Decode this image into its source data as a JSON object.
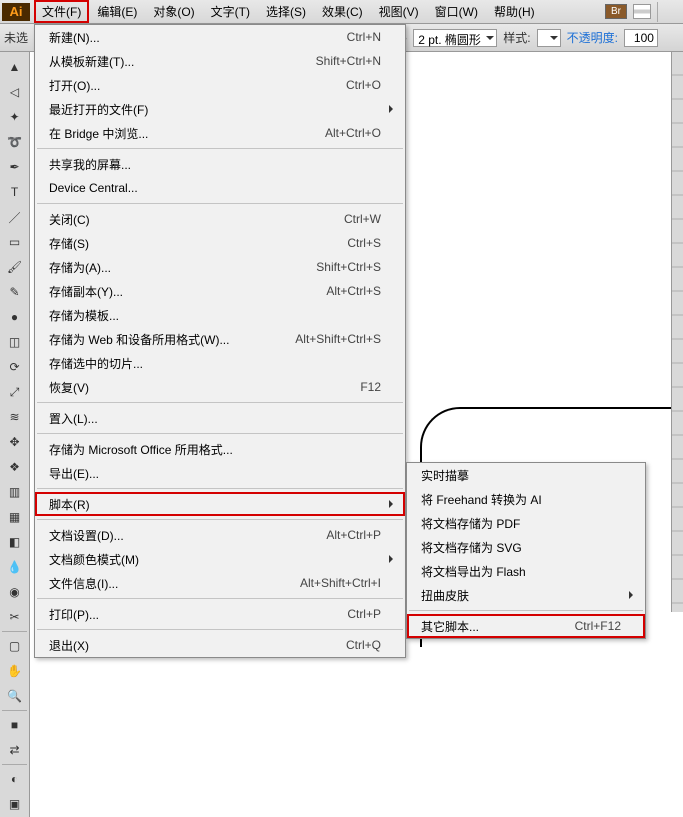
{
  "app_icon": "Ai",
  "menubar": [
    "文件(F)",
    "编辑(E)",
    "对象(O)",
    "文字(T)",
    "选择(S)",
    "效果(C)",
    "视图(V)",
    "窗口(W)",
    "帮助(H)"
  ],
  "toolbar2": {
    "doc_label": "未选",
    "stroke_label": "2 pt. 椭圆形",
    "style_label": "样式:",
    "opacity_label": "不透明度:",
    "opacity_value": "100"
  },
  "file_menu": [
    {
      "label": "新建(N)...",
      "shortcut": "Ctrl+N"
    },
    {
      "label": "从模板新建(T)...",
      "shortcut": "Shift+Ctrl+N"
    },
    {
      "label": "打开(O)...",
      "shortcut": "Ctrl+O"
    },
    {
      "label": "最近打开的文件(F)",
      "sub": true
    },
    {
      "label": "在 Bridge 中浏览...",
      "shortcut": "Alt+Ctrl+O"
    },
    {
      "sep": true
    },
    {
      "label": "共享我的屏幕..."
    },
    {
      "label": "Device Central..."
    },
    {
      "sep": true
    },
    {
      "label": "关闭(C)",
      "shortcut": "Ctrl+W"
    },
    {
      "label": "存储(S)",
      "shortcut": "Ctrl+S"
    },
    {
      "label": "存储为(A)...",
      "shortcut": "Shift+Ctrl+S"
    },
    {
      "label": "存储副本(Y)...",
      "shortcut": "Alt+Ctrl+S"
    },
    {
      "label": "存储为模板..."
    },
    {
      "label": "存储为 Web 和设备所用格式(W)...",
      "shortcut": "Alt+Shift+Ctrl+S"
    },
    {
      "label": "存储选中的切片..."
    },
    {
      "label": "恢复(V)",
      "shortcut": "F12"
    },
    {
      "sep": true
    },
    {
      "label": "置入(L)..."
    },
    {
      "sep": true
    },
    {
      "label": "存储为 Microsoft Office 所用格式..."
    },
    {
      "label": "导出(E)..."
    },
    {
      "sep": true
    },
    {
      "label": "脚本(R)",
      "sub": true,
      "hl": true
    },
    {
      "sep": true
    },
    {
      "label": "文档设置(D)...",
      "shortcut": "Alt+Ctrl+P"
    },
    {
      "label": "文档颜色模式(M)",
      "sub": true
    },
    {
      "label": "文件信息(I)...",
      "shortcut": "Alt+Shift+Ctrl+I"
    },
    {
      "sep": true
    },
    {
      "label": "打印(P)...",
      "shortcut": "Ctrl+P"
    },
    {
      "sep": true
    },
    {
      "label": "退出(X)",
      "shortcut": "Ctrl+Q"
    }
  ],
  "submenu": [
    {
      "label": "实时描摹"
    },
    {
      "label": "将 Freehand 转换为 AI"
    },
    {
      "label": "将文档存储为 PDF"
    },
    {
      "label": "将文档存储为 SVG"
    },
    {
      "label": "将文档导出为 Flash"
    },
    {
      "label": "扭曲皮肤",
      "sub": true
    },
    {
      "sep": true
    },
    {
      "label": "其它脚本...",
      "shortcut": "Ctrl+F12",
      "hl": true
    }
  ],
  "tools": [
    "selection",
    "direct-select",
    "magic-wand",
    "lasso",
    "pen",
    "type",
    "line",
    "rectangle",
    "brush",
    "pencil",
    "blob",
    "eraser",
    "rotate",
    "scale",
    "warp",
    "free-transform",
    "symbol",
    "graph",
    "mesh",
    "gradient",
    "eyedropper",
    "blend",
    "slice",
    "sep",
    "artboard",
    "hand",
    "zoom",
    "sep",
    "fill",
    "stroke-swap",
    "sep",
    "colormode",
    "screenmode"
  ]
}
